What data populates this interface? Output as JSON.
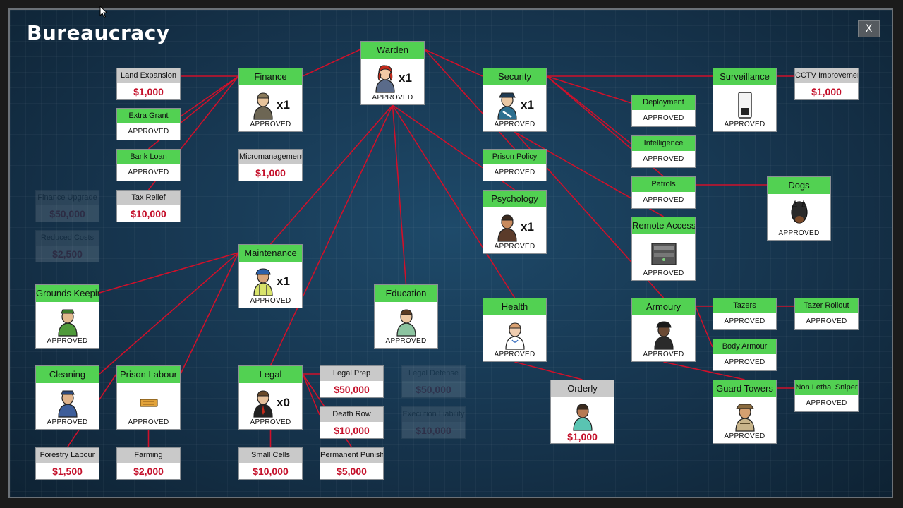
{
  "window": {
    "title": "Bureaucracy",
    "close_label": "X"
  },
  "colors": {
    "approved_header": "#52d152",
    "locked_header": "#c9c9c9",
    "price": "#c4102a",
    "link": "#d0102a"
  },
  "nodes": {
    "warden": {
      "label": "Warden",
      "count": "x1",
      "status": "APPROVED",
      "icon": "warden-icon"
    },
    "finance": {
      "label": "Finance",
      "count": "x1",
      "status": "APPROVED",
      "icon": "accountant-icon"
    },
    "security": {
      "label": "Security",
      "count": "x1",
      "status": "APPROVED",
      "icon": "security-chief-icon"
    },
    "surveillance": {
      "label": "Surveillance",
      "status": "APPROVED",
      "icon": "cctv-monitor-icon"
    },
    "cctv_improvement": {
      "label": "CCTV Improvement",
      "price": "$1,000"
    },
    "land_expansion": {
      "label": "Land Expansion",
      "price": "$1,000"
    },
    "extra_grant": {
      "label": "Extra Grant",
      "status": "APPROVED"
    },
    "bank_loan": {
      "label": "Bank Loan",
      "status": "APPROVED"
    },
    "tax_relief": {
      "label": "Tax Relief",
      "price": "$10,000"
    },
    "micromanagement": {
      "label": "Micromanagement",
      "price": "$1,000"
    },
    "deployment": {
      "label": "Deployment",
      "status": "APPROVED"
    },
    "intelligence": {
      "label": "Intelligence",
      "status": "APPROVED"
    },
    "patrols": {
      "label": "Patrols",
      "status": "APPROVED"
    },
    "dogs": {
      "label": "Dogs",
      "status": "APPROVED",
      "icon": "dog-icon"
    },
    "remote_access": {
      "label": "Remote Access",
      "status": "APPROVED",
      "icon": "server-icon"
    },
    "prison_policy": {
      "label": "Prison Policy",
      "status": "APPROVED"
    },
    "psychology": {
      "label": "Psychology",
      "count": "x1",
      "status": "APPROVED",
      "icon": "psychologist-icon"
    },
    "maintenance": {
      "label": "Maintenance",
      "count": "x1",
      "status": "APPROVED",
      "icon": "foreman-icon"
    },
    "grounds_keeping": {
      "label": "Grounds Keeping",
      "status": "APPROVED",
      "icon": "gardener-icon"
    },
    "education": {
      "label": "Education",
      "status": "APPROVED",
      "icon": "teacher-icon"
    },
    "health": {
      "label": "Health",
      "status": "APPROVED",
      "icon": "doctor-icon"
    },
    "armoury": {
      "label": "Armoury",
      "status": "APPROVED",
      "icon": "armed-guard-icon"
    },
    "tazers": {
      "label": "Tazers",
      "status": "APPROVED"
    },
    "tazer_rollout": {
      "label": "Tazer Rollout",
      "status": "APPROVED"
    },
    "body_armour": {
      "label": "Body Armour",
      "status": "APPROVED"
    },
    "guard_towers": {
      "label": "Guard Towers",
      "status": "APPROVED",
      "icon": "tower-guard-icon"
    },
    "non_lethal_sniper": {
      "label": "Non Lethal Sniper",
      "status": "APPROVED"
    },
    "cleaning": {
      "label": "Cleaning",
      "status": "APPROVED",
      "icon": "janitor-icon"
    },
    "prison_labour": {
      "label": "Prison Labour",
      "status": "APPROVED",
      "icon": "workshop-icon"
    },
    "legal": {
      "label": "Legal",
      "count": "x0",
      "status": "APPROVED",
      "icon": "lawyer-icon"
    },
    "legal_prep": {
      "label": "Legal Prep",
      "price": "$50,000"
    },
    "death_row": {
      "label": "Death Row",
      "price": "$10,000"
    },
    "small_cells": {
      "label": "Small Cells",
      "price": "$10,000"
    },
    "permanent_punishments": {
      "label": "Permanent Punishments",
      "price": "$5,000"
    },
    "forestry_labour": {
      "label": "Forestry Labour",
      "price": "$1,500"
    },
    "farming": {
      "label": "Farming",
      "price": "$2,000"
    },
    "orderly": {
      "label": "Orderly",
      "price": "$1,000",
      "icon": "orderly-icon"
    },
    "locked_finance_a": {
      "label": "Finance Upgrade",
      "price": "$50,000"
    },
    "locked_finance_b": {
      "label": "Reduced Costs",
      "price": "$2,500"
    },
    "locked_legal_a": {
      "label": "Legal Defense",
      "price": "$50,000"
    },
    "locked_legal_b": {
      "label": "Execution Liability",
      "price": "$10,000"
    }
  }
}
